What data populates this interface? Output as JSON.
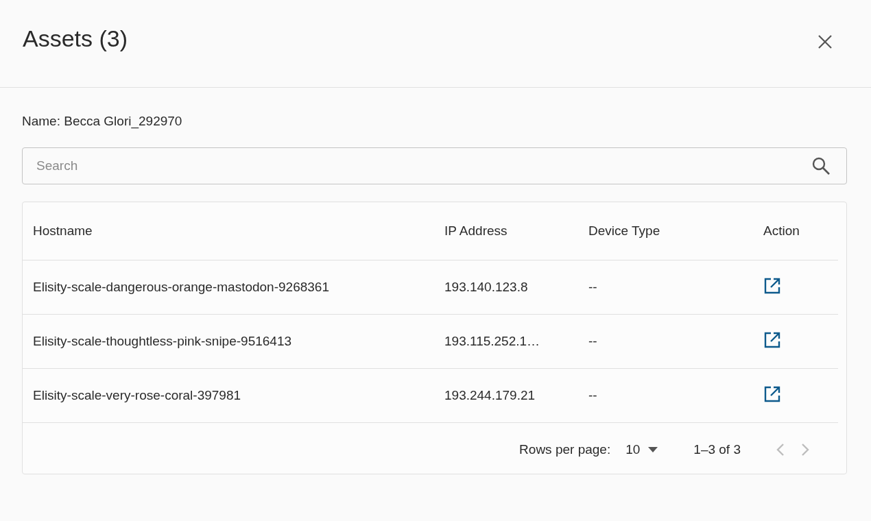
{
  "dialog": {
    "title": "Assets (3)"
  },
  "owner_label": "Name: Becca Glori_292970",
  "search": {
    "placeholder": "Search"
  },
  "table": {
    "columns": [
      "Hostname",
      "IP Address",
      "Device Type",
      "Action"
    ],
    "rows": [
      {
        "hostname": "Elisity-scale-dangerous-orange-mastodon-9268361",
        "ip": "193.140.123.8",
        "device_type": "--"
      },
      {
        "hostname": "Elisity-scale-thoughtless-pink-snipe-9516413",
        "ip": "193.115.252.1…",
        "device_type": "--"
      },
      {
        "hostname": "Elisity-scale-very-rose-coral-397981",
        "ip": "193.244.179.21",
        "device_type": "--"
      }
    ]
  },
  "pagination": {
    "rows_per_page_label": "Rows per page:",
    "rows_per_page": "10",
    "range": "1–3 of 3",
    "prev_disabled": true,
    "next_disabled": true
  }
}
